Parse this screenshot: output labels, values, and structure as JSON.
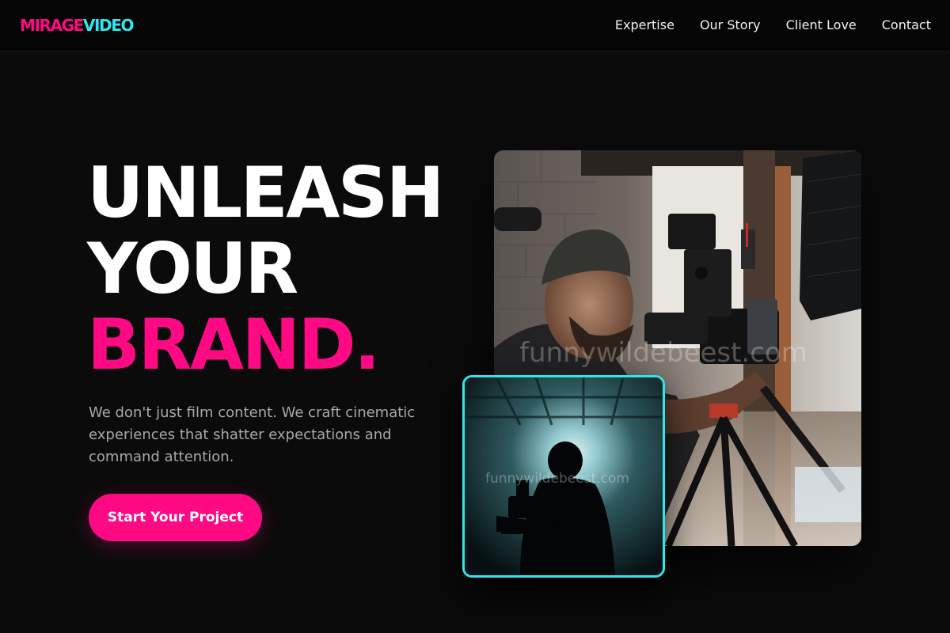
{
  "brand": {
    "part1": "MIRAGE",
    "part2": "VIDEO"
  },
  "nav": {
    "items": [
      {
        "label": "Expertise"
      },
      {
        "label": "Our Story"
      },
      {
        "label": "Client Love"
      },
      {
        "label": "Contact"
      }
    ]
  },
  "hero": {
    "line1": "UNLEASH",
    "line2": "YOUR",
    "line3": "BRAND.",
    "subtitle": "We don't just film content. We craft cinematic experiences that shatter expectations and command attention.",
    "cta_label": "Start Your Project"
  },
  "images": {
    "main_watermark": "funnywildebeest.com",
    "inset_watermark": "funnywildebeest.com"
  },
  "colors": {
    "accent_pink": "#ff0a84",
    "accent_cyan": "#2ee6ee",
    "background": "#0c0b0c"
  }
}
